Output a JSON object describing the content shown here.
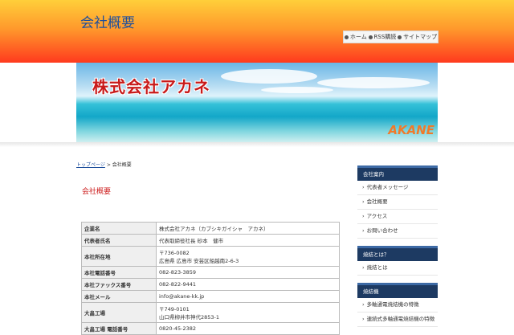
{
  "header": {
    "site_title": "会社概要",
    "nav": [
      "ホーム",
      "RSS購読",
      "サイトマップ"
    ]
  },
  "banner": {
    "title": "株式会社アカネ",
    "logo": "AKANE"
  },
  "breadcrumb": {
    "home": "トップページ",
    "separator": ">",
    "current": "会社概要"
  },
  "main": {
    "heading": "会社概要",
    "rows": [
      {
        "label": "企業名",
        "value": "株式会社アカネ（カブシキガイシャ　アカネ）"
      },
      {
        "label": "代表者氏名",
        "value": "代表取締役社長 砂本　健市"
      },
      {
        "label": "本社所在地",
        "value": "〒736-0082",
        "value2": "広島県 広島市 安芸区船越南2-6-3"
      },
      {
        "label": "本社電話番号",
        "value": "082-823-3859"
      },
      {
        "label": "本社ファックス番号",
        "value": "082-822-9441"
      },
      {
        "label": "本社メール",
        "value": "info@akane-kk.jp"
      },
      {
        "label": "大畠工場",
        "value": "〒749-0101",
        "value2": "山口県柳井市神代2853-1"
      },
      {
        "label": "大畠工場 電話番号",
        "value": "0820-45-2382"
      }
    ]
  },
  "sidebar": {
    "sections": [
      {
        "title": "会社案内",
        "items": [
          "代表者メッセージ",
          "会社概要",
          "アクセス",
          "お問い合わせ"
        ]
      },
      {
        "title": "焼結とは？",
        "items": [
          "焼結とは"
        ]
      },
      {
        "title": "焼結機",
        "items": [
          "多軸通電焼結機の特徴",
          "連続式多軸通電焼結機の特徴"
        ]
      }
    ]
  },
  "colors": {
    "header_top": "#ffcf3a",
    "header_bottom": "#ff3a1e",
    "title_blue": "#1e4f9c",
    "heading_red": "#cc1a1a",
    "sidebar_head": "#1d3a62"
  }
}
